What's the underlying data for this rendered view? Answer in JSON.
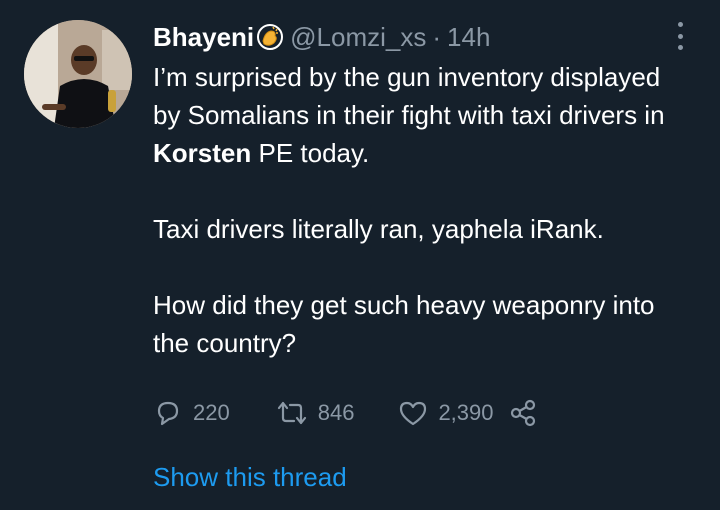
{
  "tweet": {
    "author": {
      "name": "Bhayeni",
      "handle": "@Lomzi_xs",
      "separator": "·",
      "time": "14h"
    },
    "text": {
      "p1_part1": "I’m surprised by the gun inventory displayed by Somalians in their fight with taxi drivers in ",
      "p1_bold": "Korsten",
      "p1_part2": " PE today.",
      "p2": "Taxi drivers literally ran, yaphela iRank.",
      "p3": "How did they get such heavy weaponry into the country?"
    },
    "stats": {
      "replies": "220",
      "retweets": "846",
      "likes": "2,390"
    },
    "show_thread": "Show this thread"
  },
  "icons": {
    "badge": "clapping-hands-icon",
    "more": "more-icon",
    "reply": "reply-icon",
    "retweet": "retweet-icon",
    "like": "heart-icon",
    "share": "share-icon"
  },
  "colors": {
    "background": "#15202b",
    "text": "#ffffff",
    "secondary": "#8b98a5",
    "link": "#1d9bf0"
  }
}
